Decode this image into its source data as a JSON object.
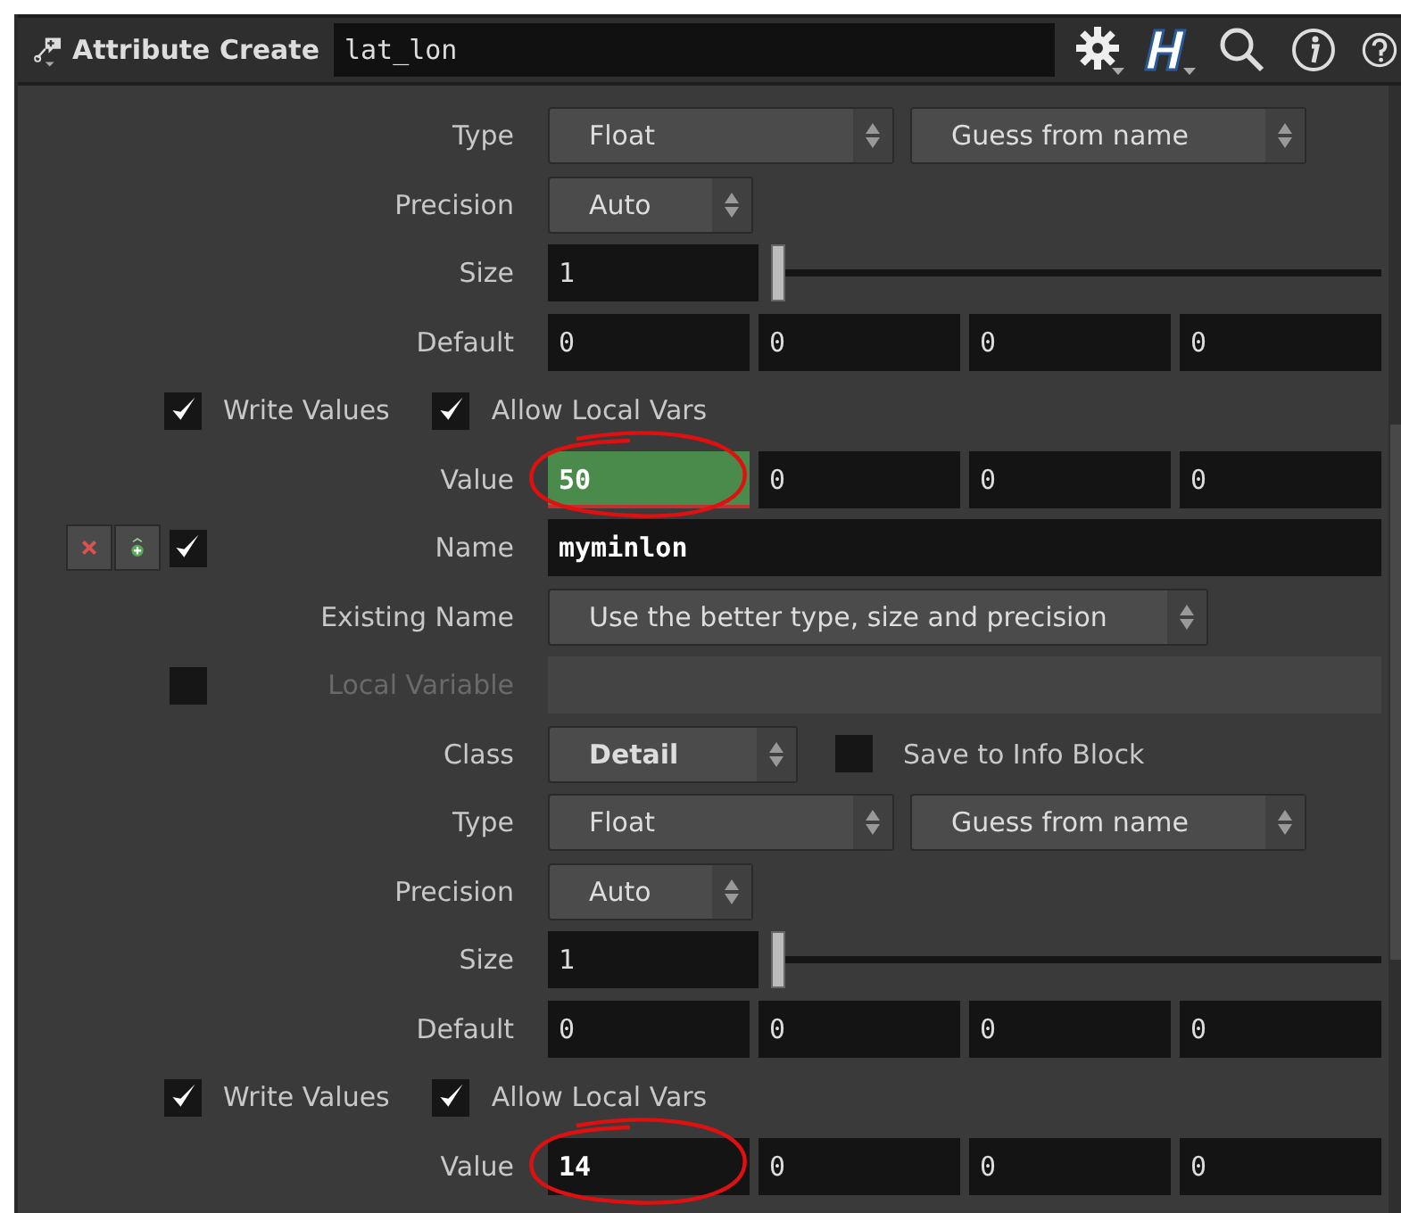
{
  "header": {
    "title": "Attribute Create",
    "name": "lat_lon"
  },
  "rows": [
    {
      "kind": "menus",
      "label": "Type",
      "menus": [
        {
          "text": "Float"
        },
        {
          "text": "Guess from name"
        }
      ]
    },
    {
      "kind": "menus",
      "label": "Precision",
      "menus": [
        {
          "text": "Auto"
        }
      ]
    },
    {
      "kind": "slider",
      "label": "Size",
      "value": "1",
      "level": 0
    },
    {
      "kind": "vector",
      "label": "Default",
      "values": [
        "0",
        "0",
        "0",
        "0"
      ],
      "highlighted": false,
      "circled": false
    },
    {
      "kind": "checks",
      "checks": [
        {
          "label": "Write Values",
          "checked": true
        },
        {
          "label": "Allow Local Vars",
          "checked": true
        }
      ]
    },
    {
      "kind": "vector",
      "label": "Value",
      "values": [
        "50",
        "0",
        "0",
        "0"
      ],
      "highlighted": true,
      "circled": true
    },
    {
      "kind": "name",
      "label": "Name",
      "value": "myminlon",
      "checked": true
    },
    {
      "kind": "menus",
      "label": "Existing Name",
      "menus": [
        {
          "text": "Use the better type, size and precision"
        }
      ]
    },
    {
      "kind": "disabled",
      "label": "Local Variable",
      "checked": false
    },
    {
      "kind": "class",
      "label": "Class",
      "menu": "Detail",
      "check": {
        "label": "Save to Info Block",
        "checked": false
      }
    },
    {
      "kind": "menus",
      "label": "Type",
      "menus": [
        {
          "text": "Float"
        },
        {
          "text": "Guess from name"
        }
      ]
    },
    {
      "kind": "menus",
      "label": "Precision",
      "menus": [
        {
          "text": "Auto"
        }
      ]
    },
    {
      "kind": "slider",
      "label": "Size",
      "value": "1",
      "level": 0
    },
    {
      "kind": "vector",
      "label": "Default",
      "values": [
        "0",
        "0",
        "0",
        "0"
      ],
      "highlighted": false,
      "circled": false
    },
    {
      "kind": "checks",
      "checks": [
        {
          "label": "Write Values",
          "checked": true
        },
        {
          "label": "Allow Local Vars",
          "checked": true
        }
      ]
    },
    {
      "kind": "vector",
      "label": "Value",
      "values": [
        "14",
        "0",
        "0",
        "0"
      ],
      "highlighted": false,
      "circled": true
    }
  ]
}
